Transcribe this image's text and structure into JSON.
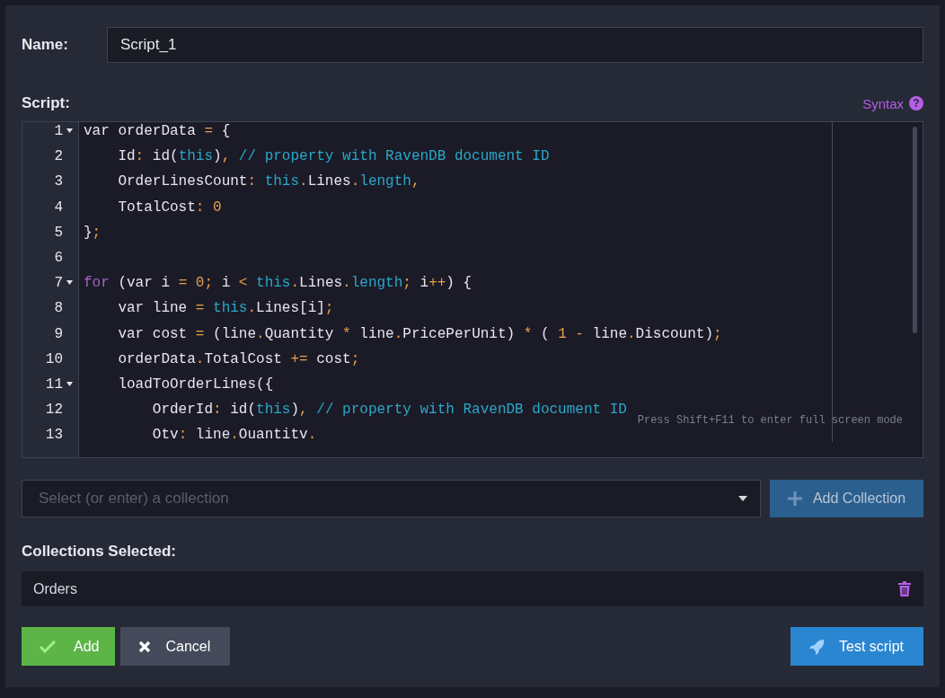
{
  "name_field": {
    "label": "Name:",
    "value": "Script_1"
  },
  "script": {
    "label": "Script:",
    "syntax_link": "Syntax",
    "syntax_icon": "?",
    "lines": [
      {
        "number": "1",
        "foldable": true,
        "tokens": [
          {
            "kind": "text",
            "text": "var orderData "
          },
          {
            "kind": "op",
            "text": "="
          },
          {
            "kind": "text",
            "text": " {"
          }
        ]
      },
      {
        "number": "2",
        "foldable": false,
        "tokens": [
          {
            "kind": "text",
            "text": "    Id"
          },
          {
            "kind": "op",
            "text": ":"
          },
          {
            "kind": "text",
            "text": " id("
          },
          {
            "kind": "builtin",
            "text": "this"
          },
          {
            "kind": "text",
            "text": ")"
          },
          {
            "kind": "op",
            "text": ","
          },
          {
            "kind": "comment",
            "text": " // property with RavenDB document ID"
          }
        ]
      },
      {
        "number": "3",
        "foldable": false,
        "tokens": [
          {
            "kind": "text",
            "text": "    OrderLinesCount"
          },
          {
            "kind": "op",
            "text": ": "
          },
          {
            "kind": "builtin",
            "text": "this"
          },
          {
            "kind": "op",
            "text": "."
          },
          {
            "kind": "text",
            "text": "Lines"
          },
          {
            "kind": "op",
            "text": "."
          },
          {
            "kind": "builtin",
            "text": "length"
          },
          {
            "kind": "op",
            "text": ","
          }
        ]
      },
      {
        "number": "4",
        "foldable": false,
        "tokens": [
          {
            "kind": "text",
            "text": "    TotalCost"
          },
          {
            "kind": "op",
            "text": ": "
          },
          {
            "kind": "num",
            "text": "0"
          }
        ]
      },
      {
        "number": "5",
        "foldable": false,
        "tokens": [
          {
            "kind": "text",
            "text": "}"
          },
          {
            "kind": "op",
            "text": ";"
          }
        ]
      },
      {
        "number": "6",
        "foldable": false
      },
      {
        "number": "7",
        "foldable": true,
        "tokens": [
          {
            "kind": "keyword",
            "text": "for"
          },
          {
            "kind": "text",
            "text": " (var i "
          },
          {
            "kind": "op",
            "text": "= "
          },
          {
            "kind": "num",
            "text": "0"
          },
          {
            "kind": "op",
            "text": ";"
          },
          {
            "kind": "text",
            "text": " i "
          },
          {
            "kind": "op",
            "text": "< "
          },
          {
            "kind": "builtin",
            "text": "this"
          },
          {
            "kind": "op",
            "text": "."
          },
          {
            "kind": "text",
            "text": "Lines"
          },
          {
            "kind": "op",
            "text": "."
          },
          {
            "kind": "builtin",
            "text": "length"
          },
          {
            "kind": "op",
            "text": ";"
          },
          {
            "kind": "text",
            "text": " i"
          },
          {
            "kind": "op",
            "text": "++"
          },
          {
            "kind": "text",
            "text": ") {"
          }
        ]
      },
      {
        "number": "8",
        "foldable": false,
        "tokens": [
          {
            "kind": "text",
            "text": "    var line "
          },
          {
            "kind": "op",
            "text": "= "
          },
          {
            "kind": "builtin",
            "text": "this"
          },
          {
            "kind": "op",
            "text": "."
          },
          {
            "kind": "text",
            "text": "Lines[i]"
          },
          {
            "kind": "op",
            "text": ";"
          }
        ]
      },
      {
        "number": "9",
        "foldable": false,
        "tokens": [
          {
            "kind": "text",
            "text": "    var cost "
          },
          {
            "kind": "op",
            "text": "="
          },
          {
            "kind": "text",
            "text": " (line"
          },
          {
            "kind": "op",
            "text": "."
          },
          {
            "kind": "text",
            "text": "Quantity "
          },
          {
            "kind": "op",
            "text": "*"
          },
          {
            "kind": "text",
            "text": " line"
          },
          {
            "kind": "op",
            "text": "."
          },
          {
            "kind": "text",
            "text": "PricePerUnit) "
          },
          {
            "kind": "op",
            "text": "*"
          },
          {
            "kind": "text",
            "text": " ( "
          },
          {
            "kind": "num",
            "text": "1 "
          },
          {
            "kind": "op",
            "text": "-"
          },
          {
            "kind": "text",
            "text": " line"
          },
          {
            "kind": "op",
            "text": "."
          },
          {
            "kind": "text",
            "text": "Discount)"
          },
          {
            "kind": "op",
            "text": ";"
          }
        ]
      },
      {
        "number": "10",
        "foldable": false,
        "tokens": [
          {
            "kind": "text",
            "text": "    orderData"
          },
          {
            "kind": "op",
            "text": "."
          },
          {
            "kind": "text",
            "text": "TotalCost "
          },
          {
            "kind": "op",
            "text": "+="
          },
          {
            "kind": "text",
            "text": " cost"
          },
          {
            "kind": "op",
            "text": ";"
          }
        ]
      },
      {
        "number": "11",
        "foldable": true,
        "tokens": [
          {
            "kind": "text",
            "text": "    loadToOrderLines({"
          }
        ]
      },
      {
        "number": "12",
        "foldable": false,
        "tokens": [
          {
            "kind": "text",
            "text": "        OrderId"
          },
          {
            "kind": "op",
            "text": ":"
          },
          {
            "kind": "text",
            "text": " id("
          },
          {
            "kind": "builtin",
            "text": "this"
          },
          {
            "kind": "text",
            "text": ")"
          },
          {
            "kind": "op",
            "text": ","
          },
          {
            "kind": "comment",
            "text": " // property with RavenDB document ID"
          }
        ]
      },
      {
        "number": "13",
        "foldable": false,
        "tokens": [
          {
            "kind": "text",
            "text": "        Otv"
          },
          {
            "kind": "op",
            "text": ":"
          },
          {
            "kind": "text",
            "text": " line"
          },
          {
            "kind": "op",
            "text": "."
          },
          {
            "kind": "text",
            "text": "Ouantitv"
          },
          {
            "kind": "op",
            "text": "."
          }
        ]
      }
    ],
    "hint": "Press Shift+F11 to enter full screen mode"
  },
  "collection_select": {
    "placeholder": "Select (or enter) a collection",
    "add_button": "Add Collection",
    "add_disabled": true
  },
  "collections_selected": {
    "label": "Collections Selected:",
    "items": [
      {
        "name": "Orders"
      }
    ]
  },
  "buttons": [
    {
      "kind": "add",
      "label": "Add"
    },
    {
      "kind": "cancel",
      "label": "Cancel"
    },
    {
      "kind": "test",
      "label": "Test script"
    }
  ]
}
